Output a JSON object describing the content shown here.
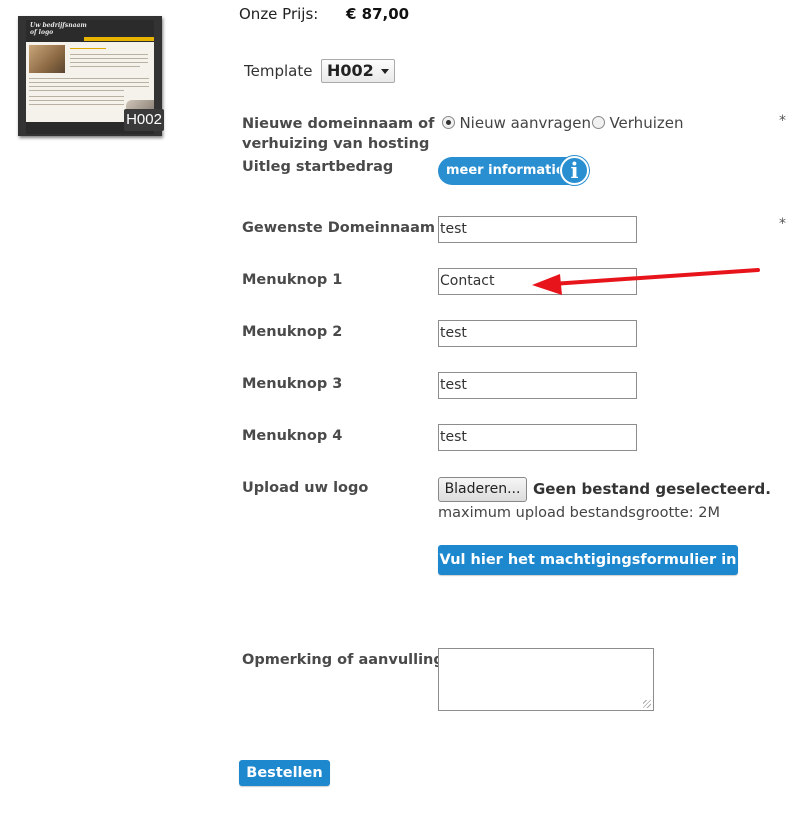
{
  "thumbnail": {
    "logo_line1": "Uw bedrijfsnaam",
    "logo_line2": "of logo",
    "badge": "H002"
  },
  "price": {
    "label": "Onze Prijs:",
    "value": "€ 87,00"
  },
  "template": {
    "label": "Template",
    "selected": "H002"
  },
  "domain_option": {
    "label_line1": "Nieuwe domeinnaam of",
    "label_line2": "verhuizing van hosting",
    "options": [
      {
        "label": "Nieuw aanvragen",
        "selected": true
      },
      {
        "label": "Verhuizen",
        "selected": false
      }
    ],
    "required_mark": "*"
  },
  "startbedrag": {
    "label": "Uitleg startbedrag",
    "button_label": "meer informatie",
    "button_icon": "info-icon"
  },
  "fields": {
    "domain": {
      "label": "Gewenste Domeinnaam",
      "value": "test",
      "required_mark": "*"
    },
    "menu1": {
      "label": "Menuknop 1",
      "value": "Contact"
    },
    "menu2": {
      "label": "Menuknop 2",
      "value": "test"
    },
    "menu3": {
      "label": "Menuknop 3",
      "value": "test"
    },
    "menu4": {
      "label": "Menuknop 4",
      "value": "test"
    }
  },
  "upload": {
    "label": "Upload uw logo",
    "button_label": "Bladeren...",
    "status": "Geen bestand geselecteerd.",
    "max_size": "maximum upload bestandsgrootte: 2M"
  },
  "machtiging_button": "Vul hier het machtigingsformulier in",
  "remark": {
    "label": "Opmerking of aanvulling",
    "value": ""
  },
  "order_button": "Bestellen",
  "colors": {
    "accent_blue": "#1e88cf",
    "annotation_red": "#e8141b"
  }
}
